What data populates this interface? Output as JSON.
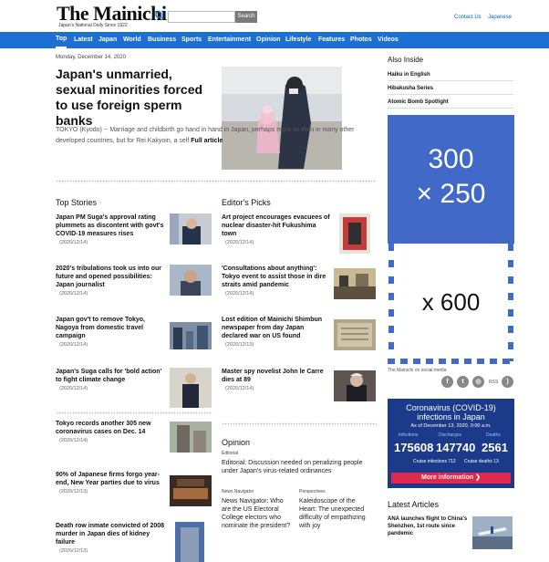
{
  "header": {
    "logo": "The Mainichi",
    "tagline": "Japan's National Daily Since 1922",
    "search_placeholder": "",
    "search_button": "Search",
    "contact_us": "Contact Us",
    "japanese": "Japanese"
  },
  "nav": [
    "Top",
    "Latest",
    "Japan",
    "World",
    "Business",
    "Sports",
    "Entertainment",
    "Opinion",
    "Lifestyle",
    "Features",
    "Photos",
    "Videos"
  ],
  "date": "Monday, December 14, 2020",
  "lead": {
    "title": "Japan's unmarried, sexual minorities forced to use foreign sperm banks",
    "body": "TOKYO (Kyodo) -- Marriage and childbirth go hand in hand in Japan, perhaps more so than in many other developed countries, but for Rei Kakyoin, a self",
    "more": "Full article"
  },
  "top_stories": {
    "heading": "Top Stories",
    "items": [
      {
        "title": "Japan PM Suga's approval rating plummets as discontent with govt's COVID-19 measures rises",
        "date": "(2020/12/14)"
      },
      {
        "title": "2020's tribulations took us into our future and opened possibilities: Japan journalist",
        "date": "(2020/12/14)"
      },
      {
        "title": "Japan gov't to remove Tokyo, Nagoya from domestic travel campaign",
        "date": "(2020/12/14)"
      },
      {
        "title": "Japan's Suga calls for 'bold action' to fight climate change",
        "date": "(2020/12/14)"
      },
      {
        "title": "Tokyo records another 305 new coronavirus cases on Dec. 14",
        "date": "(2020/12/14)"
      },
      {
        "title": "90% of Japanese firms forgo year-end, New Year parties due to virus",
        "date": "(2020/12/13)"
      },
      {
        "title": "Death row inmate convicted of 2008 murder in Japan dies of kidney failure",
        "date": "(2020/12/13)"
      }
    ]
  },
  "editors_picks": {
    "heading": "Editor's Picks",
    "items": [
      {
        "title": "Art project encourages evacuees of nuclear disaster-hit Fukushima town",
        "date": "(2020/12/14)"
      },
      {
        "title": "'Consultations about anything': Tokyo event to assist those in dire straits amid pandemic",
        "date": "(2020/12/14)"
      },
      {
        "title": "Lost edition of Mainichi Shimbun newspaper from day Japan declared war on US found",
        "date": "(2020/12/13)"
      },
      {
        "title": "Master spy novelist John le Carre dies at 89",
        "date": "(2020/12/14)"
      }
    ]
  },
  "opinion": {
    "heading": "Opinion",
    "editorial_label": "Editorial",
    "editorial_text": "Editorial: Discussion needed on penalizing people under Japan's virus-related ordinances",
    "nav_label": "News Navigator",
    "nav_text": "News Navigator: Who are the US Electoral College electors who nominate the president?",
    "persp_label": "Perspectives",
    "persp_text": "Kaleidoscope of the Heart: The unexpected difficulty of empathizing with joy"
  },
  "sidebar": {
    "also_inside": "Also Inside",
    "links": [
      "Haiku in English",
      "Hibakusha Series",
      "Atomic Bomb Spotlight"
    ],
    "ad_line1": "300",
    "ad_line2": "× 250",
    "ad_line3": "x 600",
    "social_label": "The Mainichi on social media",
    "rss": "RSS"
  },
  "covid": {
    "title1": "Coronavirus (COVID-19)",
    "title2": "infections in Japan",
    "as_of": "As of December 13, 2020, 0:00 a.m.",
    "labels": [
      "Infections",
      "Discharges",
      "Deaths"
    ],
    "values": [
      "175608",
      "147740",
      "2561"
    ],
    "cruise_inf": "Cruise infections 712",
    "cruise_deaths": "Cruise deaths 13",
    "button": "More information ❯"
  },
  "latest": {
    "heading": "Latest Articles",
    "title": "ANA launches flight to China's Shenzhen, 1st route since pandemic"
  }
}
